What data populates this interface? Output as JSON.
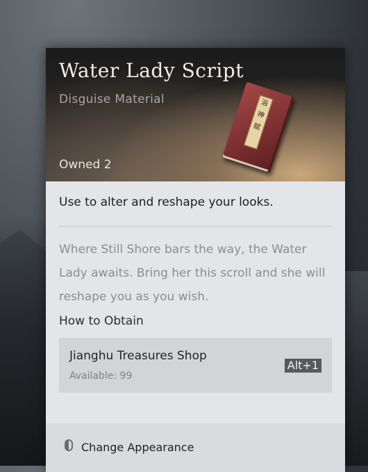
{
  "item": {
    "title": "Water Lady Script",
    "category": "Disguise Material",
    "owned": "Owned 2",
    "book_label": "浴 神 赋",
    "description": "Use to alter and reshape your looks.",
    "lore": "Where Still Shore bars the way, the Water Lady awaits. Bring her this scroll and she will reshape you as you wish."
  },
  "obtain": {
    "heading": "How to Obtain",
    "source": "Jianghu Treasures Shop",
    "available": "Available: 99",
    "hotkey": "Alt+1"
  },
  "footer": {
    "action_label": "Change Appearance",
    "action_icon": "mouse-icon"
  }
}
